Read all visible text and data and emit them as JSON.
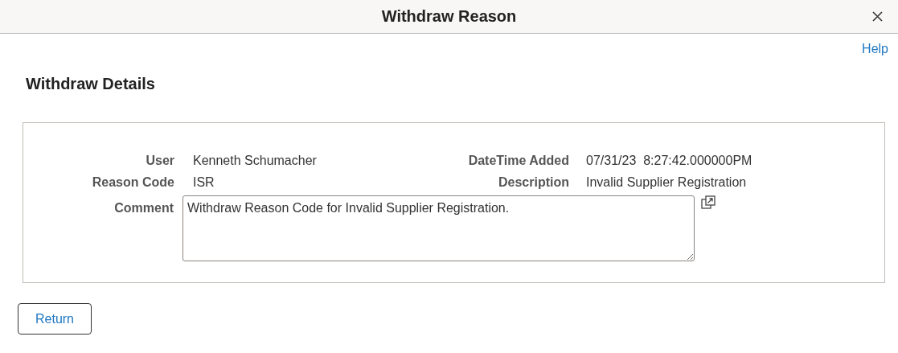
{
  "window": {
    "title": "Withdraw Reason"
  },
  "help_link": "Help",
  "section_title": "Withdraw Details",
  "fields": [
    {
      "label": "User",
      "value": "Kenneth Schumacher"
    },
    {
      "label": "DateTime Added",
      "value": "07/31/23  8:27:42.000000PM"
    },
    {
      "label": "Reason Code",
      "value": "ISR"
    },
    {
      "label": "Description",
      "value": "Invalid Supplier Registration"
    }
  ],
  "comment": {
    "label": "Comment",
    "value": "Withdraw Reason Code for Invalid Supplier Registration."
  },
  "buttons": [
    "Return"
  ]
}
